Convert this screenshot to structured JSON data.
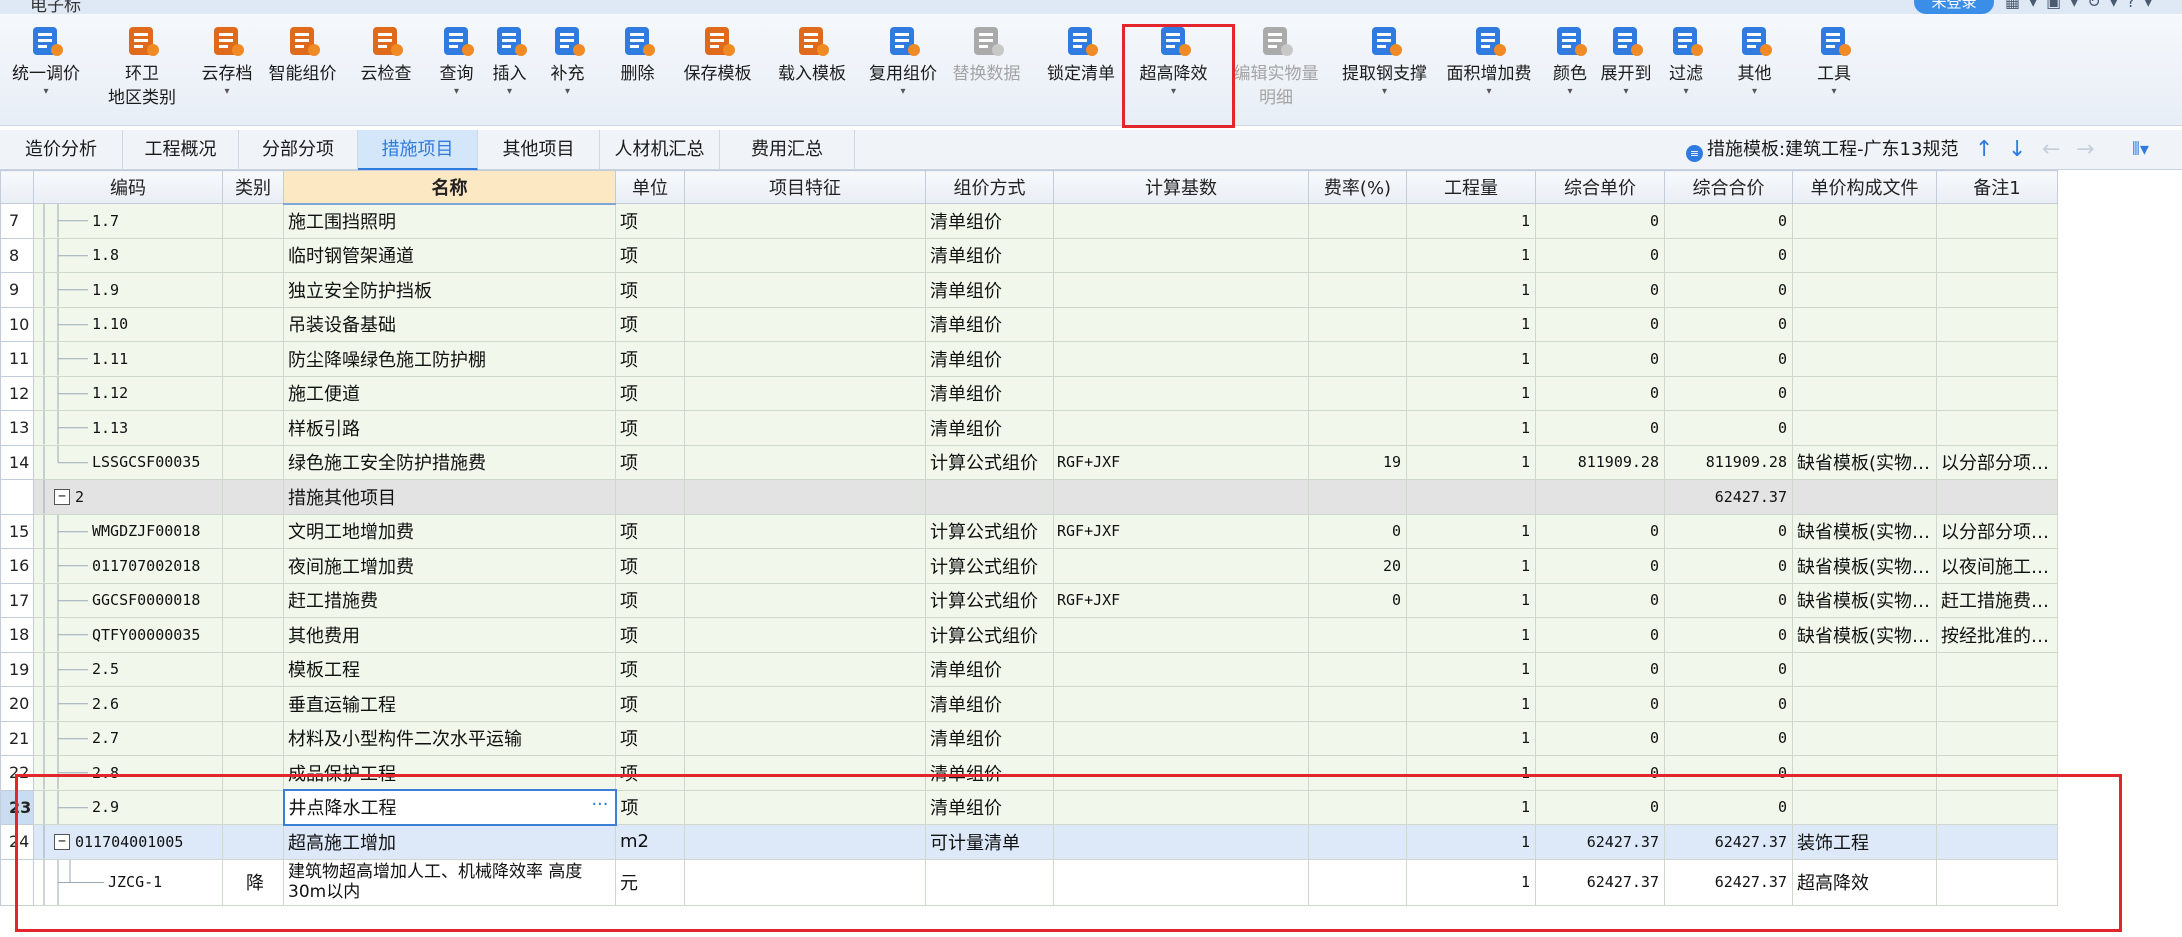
{
  "app": {
    "title": "电子标",
    "login_label": "未登录",
    "window_icons": "▦▾▣▾↻▾?▾"
  },
  "ribbon": [
    {
      "name": "unify-price",
      "label": "统一调价",
      "label2": "",
      "icon": "unify-icon",
      "color": "#2f7be0",
      "caret": true,
      "disabled": false
    },
    {
      "name": "sanitation-area",
      "label": "环卫",
      "label2": "地区类别",
      "icon": "sanitation-icon",
      "color": "#e06a1b",
      "caret": false,
      "disabled": false
    },
    {
      "name": "cloud-archive",
      "label": "云存档",
      "label2": "",
      "icon": "cloud-upload-icon",
      "color": "#e06a1b",
      "caret": true,
      "disabled": false
    },
    {
      "name": "smart-pricing",
      "label": "智能组价",
      "label2": "",
      "icon": "smart-pricing-icon",
      "color": "#e06a1b",
      "caret": false,
      "disabled": false
    },
    {
      "name": "cloud-check",
      "label": "云检查",
      "label2": "",
      "icon": "cloud-check-icon",
      "color": "#e06a1b",
      "caret": false,
      "disabled": false
    },
    {
      "name": "query",
      "label": "查询",
      "label2": "",
      "icon": "query-icon",
      "color": "#2f7be0",
      "caret": true,
      "disabled": false
    },
    {
      "name": "insert",
      "label": "插入",
      "label2": "",
      "icon": "insert-icon",
      "color": "#2f7be0",
      "caret": true,
      "disabled": false
    },
    {
      "name": "supplement",
      "label": "补充",
      "label2": "",
      "icon": "supplement-icon",
      "color": "#2f7be0",
      "caret": true,
      "disabled": false
    },
    {
      "name": "delete",
      "label": "删除",
      "label2": "",
      "icon": "trash-icon",
      "color": "#2f7be0",
      "caret": false,
      "disabled": false
    },
    {
      "name": "save-template",
      "label": "保存模板",
      "label2": "",
      "icon": "save-template-icon",
      "color": "#e06a1b",
      "caret": false,
      "disabled": false
    },
    {
      "name": "load-template",
      "label": "载入模板",
      "label2": "",
      "icon": "load-template-icon",
      "color": "#e06a1b",
      "caret": false,
      "disabled": false
    },
    {
      "name": "reuse-pricing",
      "label": "复用组价",
      "label2": "",
      "icon": "reuse-pricing-icon",
      "color": "#2f7be0",
      "caret": true,
      "disabled": false
    },
    {
      "name": "replace-data",
      "label": "替换数据",
      "label2": "",
      "icon": "replace-data-icon",
      "color": "#aaaaaa",
      "caret": false,
      "disabled": true
    },
    {
      "name": "lock-list",
      "label": "锁定清单",
      "label2": "",
      "icon": "lock-icon",
      "color": "#2f7be0",
      "caret": false,
      "disabled": false
    },
    {
      "name": "super-high-reduction",
      "label": "超高降效",
      "label2": "",
      "icon": "super-high-icon",
      "color": "#2f7be0",
      "caret": true,
      "disabled": false
    },
    {
      "name": "edit-quantity-detail",
      "label": "编辑实物量",
      "label2": "明细",
      "icon": "edit-quantity-icon",
      "color": "#aaaaaa",
      "caret": false,
      "disabled": true
    },
    {
      "name": "extract-steel-support",
      "label": "提取钢支撑",
      "label2": "",
      "icon": "steel-support-icon",
      "color": "#2f7be0",
      "caret": true,
      "disabled": false
    },
    {
      "name": "area-surcharge",
      "label": "面积增加费",
      "label2": "",
      "icon": "area-surcharge-icon",
      "color": "#2f7be0",
      "caret": true,
      "disabled": false
    },
    {
      "name": "color",
      "label": "颜色",
      "label2": "",
      "icon": "color-bucket-icon",
      "color": "#2f7be0",
      "caret": true,
      "disabled": false
    },
    {
      "name": "expand-to",
      "label": "展开到",
      "label2": "",
      "icon": "expand-to-icon",
      "color": "#2f7be0",
      "caret": true,
      "disabled": false
    },
    {
      "name": "filter",
      "label": "过滤",
      "label2": "",
      "icon": "filter-icon",
      "color": "#2f7be0",
      "caret": true,
      "disabled": false
    },
    {
      "name": "other",
      "label": "其他",
      "label2": "",
      "icon": "grid-icon",
      "color": "#2f7be0",
      "caret": true,
      "disabled": false
    },
    {
      "name": "tools",
      "label": "工具",
      "label2": "",
      "icon": "tools-icon",
      "color": "#2f7be0",
      "caret": true,
      "disabled": false
    }
  ],
  "tabs": [
    "造价分析",
    "工程概况",
    "分部分项",
    "措施项目",
    "其他项目",
    "人材机汇总",
    "费用汇总"
  ],
  "active_tab": "措施项目",
  "template": {
    "label": "措施模板:建筑工程-广东13规范",
    "icon": "template-icon"
  },
  "columns": [
    "编码",
    "类别",
    "名称",
    "单位",
    "项目特征",
    "组价方式",
    "计算基数",
    "费率(%)",
    "工程量",
    "综合单价",
    "综合合价",
    "单价构成文件",
    "备注1"
  ],
  "rows": [
    {
      "no": "7",
      "code": "1.7",
      "type": "",
      "name": "施工围挡照明",
      "unit": "项",
      "feature": "",
      "method": "清单组价",
      "base": "",
      "rate": "",
      "qty": "1",
      "price": "0",
      "total": "0",
      "file": "",
      "note": "",
      "style": "green",
      "level": 2
    },
    {
      "no": "8",
      "code": "1.8",
      "type": "",
      "name": "临时钢管架通道",
      "unit": "项",
      "feature": "",
      "method": "清单组价",
      "base": "",
      "rate": "",
      "qty": "1",
      "price": "0",
      "total": "0",
      "file": "",
      "note": "",
      "style": "green",
      "level": 2
    },
    {
      "no": "9",
      "code": "1.9",
      "type": "",
      "name": "独立安全防护挡板",
      "unit": "项",
      "feature": "",
      "method": "清单组价",
      "base": "",
      "rate": "",
      "qty": "1",
      "price": "0",
      "total": "0",
      "file": "",
      "note": "",
      "style": "green",
      "level": 2
    },
    {
      "no": "10",
      "code": "1.10",
      "type": "",
      "name": "吊装设备基础",
      "unit": "项",
      "feature": "",
      "method": "清单组价",
      "base": "",
      "rate": "",
      "qty": "1",
      "price": "0",
      "total": "0",
      "file": "",
      "note": "",
      "style": "green",
      "level": 2
    },
    {
      "no": "11",
      "code": "1.11",
      "type": "",
      "name": "防尘降噪绿色施工防护棚",
      "unit": "项",
      "feature": "",
      "method": "清单组价",
      "base": "",
      "rate": "",
      "qty": "1",
      "price": "0",
      "total": "0",
      "file": "",
      "note": "",
      "style": "green",
      "level": 2
    },
    {
      "no": "12",
      "code": "1.12",
      "type": "",
      "name": "施工便道",
      "unit": "项",
      "feature": "",
      "method": "清单组价",
      "base": "",
      "rate": "",
      "qty": "1",
      "price": "0",
      "total": "0",
      "file": "",
      "note": "",
      "style": "green",
      "level": 2
    },
    {
      "no": "13",
      "code": "1.13",
      "type": "",
      "name": "样板引路",
      "unit": "项",
      "feature": "",
      "method": "清单组价",
      "base": "",
      "rate": "",
      "qty": "1",
      "price": "0",
      "total": "0",
      "file": "",
      "note": "",
      "style": "green",
      "level": 2
    },
    {
      "no": "14",
      "code": "LSSGCSF00035",
      "type": "",
      "name": "绿色施工安全防护措施费",
      "unit": "项",
      "feature": "",
      "method": "计算公式组价",
      "base": "RGF+JXF",
      "rate": "19",
      "qty": "1",
      "price": "811909.28",
      "total": "811909.28",
      "file": "缺省模板(实物…",
      "note": "以分部分项…",
      "style": "green",
      "level": 2,
      "last": true
    },
    {
      "no": "",
      "code": "2",
      "type": "",
      "name": "措施其他项目",
      "unit": "",
      "feature": "",
      "method": "",
      "base": "",
      "rate": "",
      "qty": "",
      "price": "",
      "total": "62427.37",
      "file": "",
      "note": "",
      "style": "gray",
      "level": 1,
      "collapse": true
    },
    {
      "no": "15",
      "code": "WMGDZJF00018",
      "type": "",
      "name": "文明工地增加费",
      "unit": "项",
      "feature": "",
      "method": "计算公式组价",
      "base": "RGF+JXF",
      "rate": "0",
      "qty": "1",
      "price": "0",
      "total": "0",
      "file": "缺省模板(实物…",
      "note": "以分部分项…",
      "style": "green",
      "level": 2
    },
    {
      "no": "16",
      "code": "011707002018",
      "type": "",
      "name": "夜间施工增加费",
      "unit": "项",
      "feature": "",
      "method": "计算公式组价",
      "base": "",
      "rate": "20",
      "qty": "1",
      "price": "0",
      "total": "0",
      "file": "缺省模板(实物…",
      "note": "以夜间施工…",
      "style": "green",
      "level": 2
    },
    {
      "no": "17",
      "code": "GGCSF0000018",
      "type": "",
      "name": "赶工措施费",
      "unit": "项",
      "feature": "",
      "method": "计算公式组价",
      "base": "RGF+JXF",
      "rate": "0",
      "qty": "1",
      "price": "0",
      "total": "0",
      "file": "缺省模板(实物…",
      "note": "赶工措施费…",
      "style": "green",
      "level": 2
    },
    {
      "no": "18",
      "code": "QTFY00000035",
      "type": "",
      "name": "其他费用",
      "unit": "项",
      "feature": "",
      "method": "计算公式组价",
      "base": "",
      "rate": "",
      "qty": "1",
      "price": "0",
      "total": "0",
      "file": "缺省模板(实物…",
      "note": "按经批准的…",
      "style": "green",
      "level": 2
    },
    {
      "no": "19",
      "code": "2.5",
      "type": "",
      "name": "模板工程",
      "unit": "项",
      "feature": "",
      "method": "清单组价",
      "base": "",
      "rate": "",
      "qty": "1",
      "price": "0",
      "total": "0",
      "file": "",
      "note": "",
      "style": "green",
      "level": 2
    },
    {
      "no": "20",
      "code": "2.6",
      "type": "",
      "name": "垂直运输工程",
      "unit": "项",
      "feature": "",
      "method": "清单组价",
      "base": "",
      "rate": "",
      "qty": "1",
      "price": "0",
      "total": "0",
      "file": "",
      "note": "",
      "style": "green",
      "level": 2
    },
    {
      "no": "21",
      "code": "2.7",
      "type": "",
      "name": "材料及小型构件二次水平运输",
      "unit": "项",
      "feature": "",
      "method": "清单组价",
      "base": "",
      "rate": "",
      "qty": "1",
      "price": "0",
      "total": "0",
      "file": "",
      "note": "",
      "style": "green",
      "level": 2
    },
    {
      "no": "22",
      "code": "2.8",
      "type": "",
      "name": "成品保护工程",
      "unit": "项",
      "feature": "",
      "method": "清单组价",
      "base": "",
      "rate": "",
      "qty": "1",
      "price": "0",
      "total": "0",
      "file": "",
      "note": "",
      "style": "green",
      "level": 2
    },
    {
      "no": "23",
      "code": "2.9",
      "type": "",
      "name": "井点降水工程",
      "unit": "项",
      "feature": "",
      "method": "清单组价",
      "base": "",
      "rate": "",
      "qty": "1",
      "price": "0",
      "total": "0",
      "file": "",
      "note": "",
      "style": "sel",
      "level": 2,
      "editing": true
    },
    {
      "no": "24",
      "code": "011704001005",
      "type": "",
      "name": "超高施工增加",
      "unit": "m2",
      "feature": "",
      "method": "可计量清单",
      "base": "",
      "rate": "",
      "qty": "1",
      "price": "62427.37",
      "total": "62427.37",
      "file": "装饰工程",
      "note": "",
      "style": "blue",
      "level": 1,
      "collapse": true
    },
    {
      "no": "",
      "code": "JZCG-1",
      "type": "降",
      "name": "建筑物超高增加人工、机械降效率 高度30m以内",
      "unit": "元",
      "feature": "",
      "method": "",
      "base": "",
      "rate": "",
      "qty": "1",
      "price": "62427.37",
      "total": "62427.37",
      "file": "超高降效",
      "note": "",
      "style": "white",
      "level": 3,
      "tall": true
    }
  ],
  "colors": {
    "accent": "#2f7be0",
    "highlight_box": "#e3262e",
    "row_green": "#f1f8eb",
    "row_gray": "#e3e3e3",
    "row_blue": "#dde9f8"
  }
}
